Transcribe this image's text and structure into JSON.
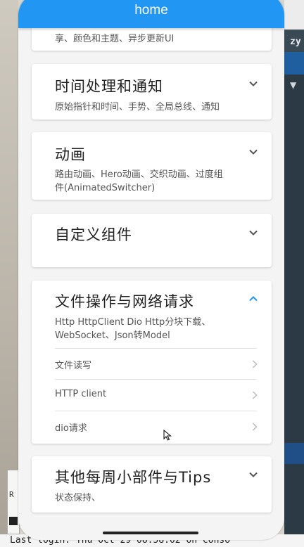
{
  "appbar": {
    "title": "home"
  },
  "cards": [
    {
      "title": "",
      "desc": "享、颜色和主题、异步更新UI",
      "expanded": false
    },
    {
      "title": "时间处理和通知",
      "desc": "原始指针和时间、手势、全局总线、通知",
      "expanded": false
    },
    {
      "title": "动画",
      "desc": "路由动画、Hero动画、交织动画、过度组件(AnimatedSwitcher)",
      "expanded": false
    },
    {
      "title": "自定义组件",
      "desc": "",
      "expanded": false
    },
    {
      "title": "文件操作与网络请求",
      "desc": "Http HttpClient Dio Http分块下载、WebSocket、Json转Model",
      "expanded": true,
      "items": [
        {
          "label": "文件读写"
        },
        {
          "label": "HTTP client"
        },
        {
          "label": "dio请求"
        }
      ]
    },
    {
      "title": "其他每周小部件与Tips",
      "desc": "状态保持、",
      "expanded": false
    }
  ],
  "desktop": {
    "right_label": "zy",
    "terminal_text": "Last login: Thu Oct 29 08:58:02 on conso",
    "terminal_box_label": "R"
  },
  "colors": {
    "primary": "#2196f3",
    "expanded_icon": "#2196f3",
    "collapsed_icon": "#555555"
  }
}
